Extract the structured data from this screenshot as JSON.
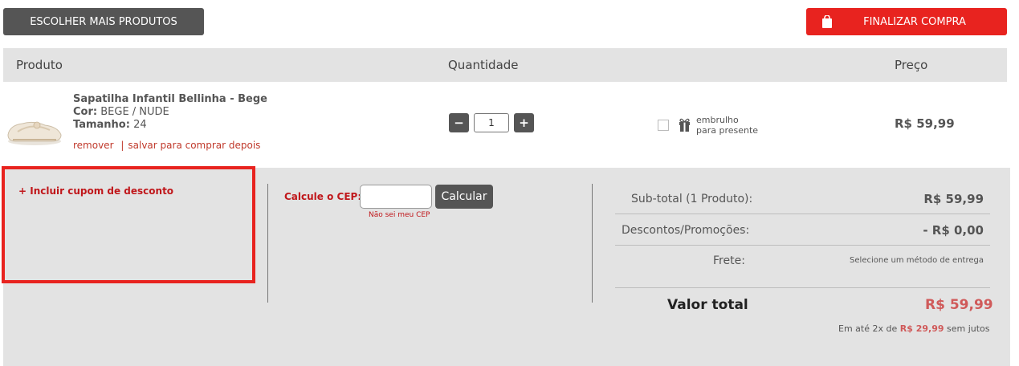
{
  "toolbar": {
    "continue_label": "ESCOLHER MAIS PRODUTOS",
    "checkout_label": "FINALIZAR COMPRA"
  },
  "table_header": {
    "product": "Produto",
    "quantity": "Quantidade",
    "price": "Preço"
  },
  "item": {
    "name": "Sapatilha Infantil Bellinha - Bege",
    "color_label": "Cor:",
    "color_value": "BEGE / NUDE",
    "size_label": "Tamanho:",
    "size_value": "24",
    "remove_label": "remover",
    "separator": "|",
    "save_label": "salvar para comprar depois",
    "quantity": "1",
    "minus": "−",
    "plus": "+",
    "gift_line1": "embrulho",
    "gift_line2": "para presente",
    "price": "R$ 59,99"
  },
  "coupon": {
    "link_label": "+ Incluir cupom de desconto"
  },
  "shipping": {
    "label": "Calcule o CEP:",
    "button_label": "Calcular",
    "help_label": "Não sei meu CEP"
  },
  "summary": {
    "subtotal_label": "Sub-total (1 Produto):",
    "subtotal_value": "R$ 59,99",
    "discount_label": "Descontos/Promoções:",
    "discount_value": "- R$ 0,00",
    "freight_label": "Frete:",
    "freight_value": "Selecione um método de entrega",
    "total_label": "Valor total",
    "total_value": "R$ 59,99",
    "installments_prefix": "Em até 2x de",
    "installments_amount": "R$ 29,99",
    "installments_suffix": "sem jutos"
  },
  "colors": {
    "accent_red": "#e8231f",
    "price_red": "#d05a5a",
    "dark_button": "#555555",
    "panel_gray": "#e3e3e3"
  },
  "icons": [
    "shopping-bag-icon",
    "gift-icon",
    "shoe-product-image"
  ]
}
